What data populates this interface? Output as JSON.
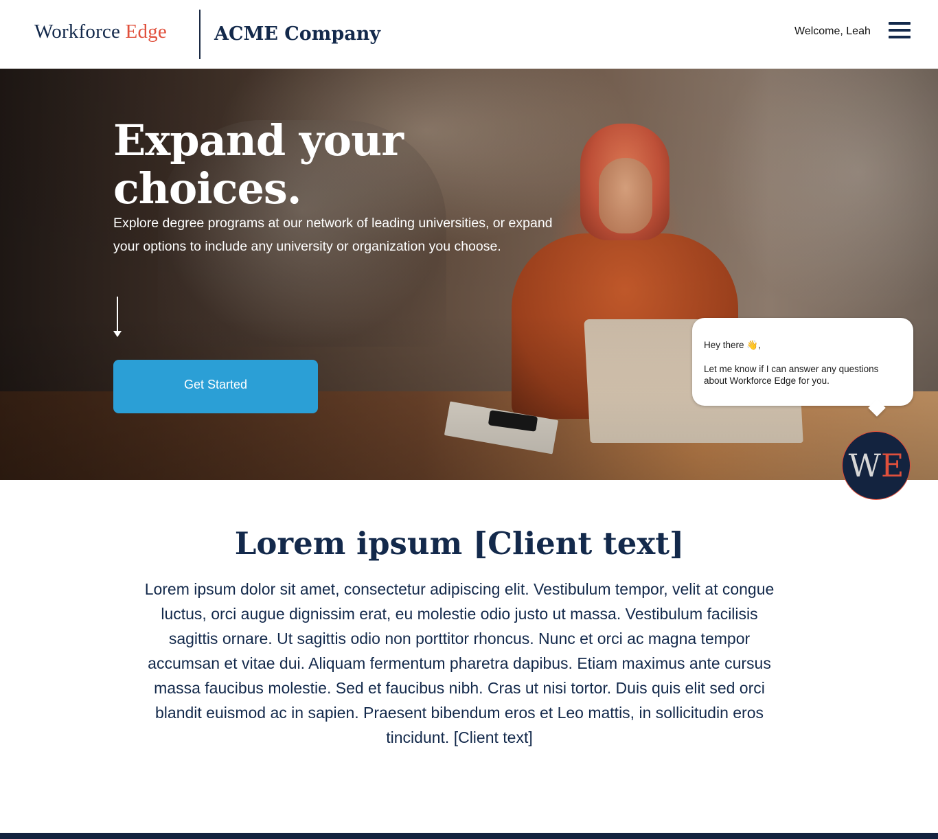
{
  "header": {
    "logo_part1": "Workforce",
    "logo_part2": "Edge",
    "company_name": "ACME Company",
    "welcome_text": "Welcome, Leah",
    "menu_icon": "hamburger-menu-icon"
  },
  "hero": {
    "title": "Expand your choices.",
    "subtitle": "Explore degree programs at our network of leading universities, or expand your options to include any university or organization you choose.",
    "scroll_icon": "arrow-down-icon",
    "cta_label": "Get Started"
  },
  "chat": {
    "greeting": "Hey there 👋,",
    "message": "Let me know if I can answer any questions about Workforce Edge for you.",
    "badge_letter1": "W",
    "badge_letter2": "E"
  },
  "content": {
    "title": "Lorem ipsum [Client text]",
    "body": "Lorem ipsum dolor sit amet, consectetur adipiscing elit. Vestibulum tempor, velit at congue luctus, orci augue dignissim erat, eu molestie odio justo ut massa. Vestibulum facilisis sagittis ornare. Ut sagittis odio non porttitor rhoncus. Nunc et orci ac magna tempor accumsan et vitae dui. Aliquam fermentum pharetra dapibus. Etiam maximus ante cursus massa faucibus molestie. Sed et faucibus nibh. Cras ut nisi tortor. Duis quis elit sed orci blandit euismod ac in sapien. Praesent bibendum eros et Leo mattis, in sollicitudin eros tincidunt. [Client text]"
  },
  "colors": {
    "navy": "#13294b",
    "accent_red": "#e0503c",
    "cta_blue": "#2b9fd6"
  }
}
